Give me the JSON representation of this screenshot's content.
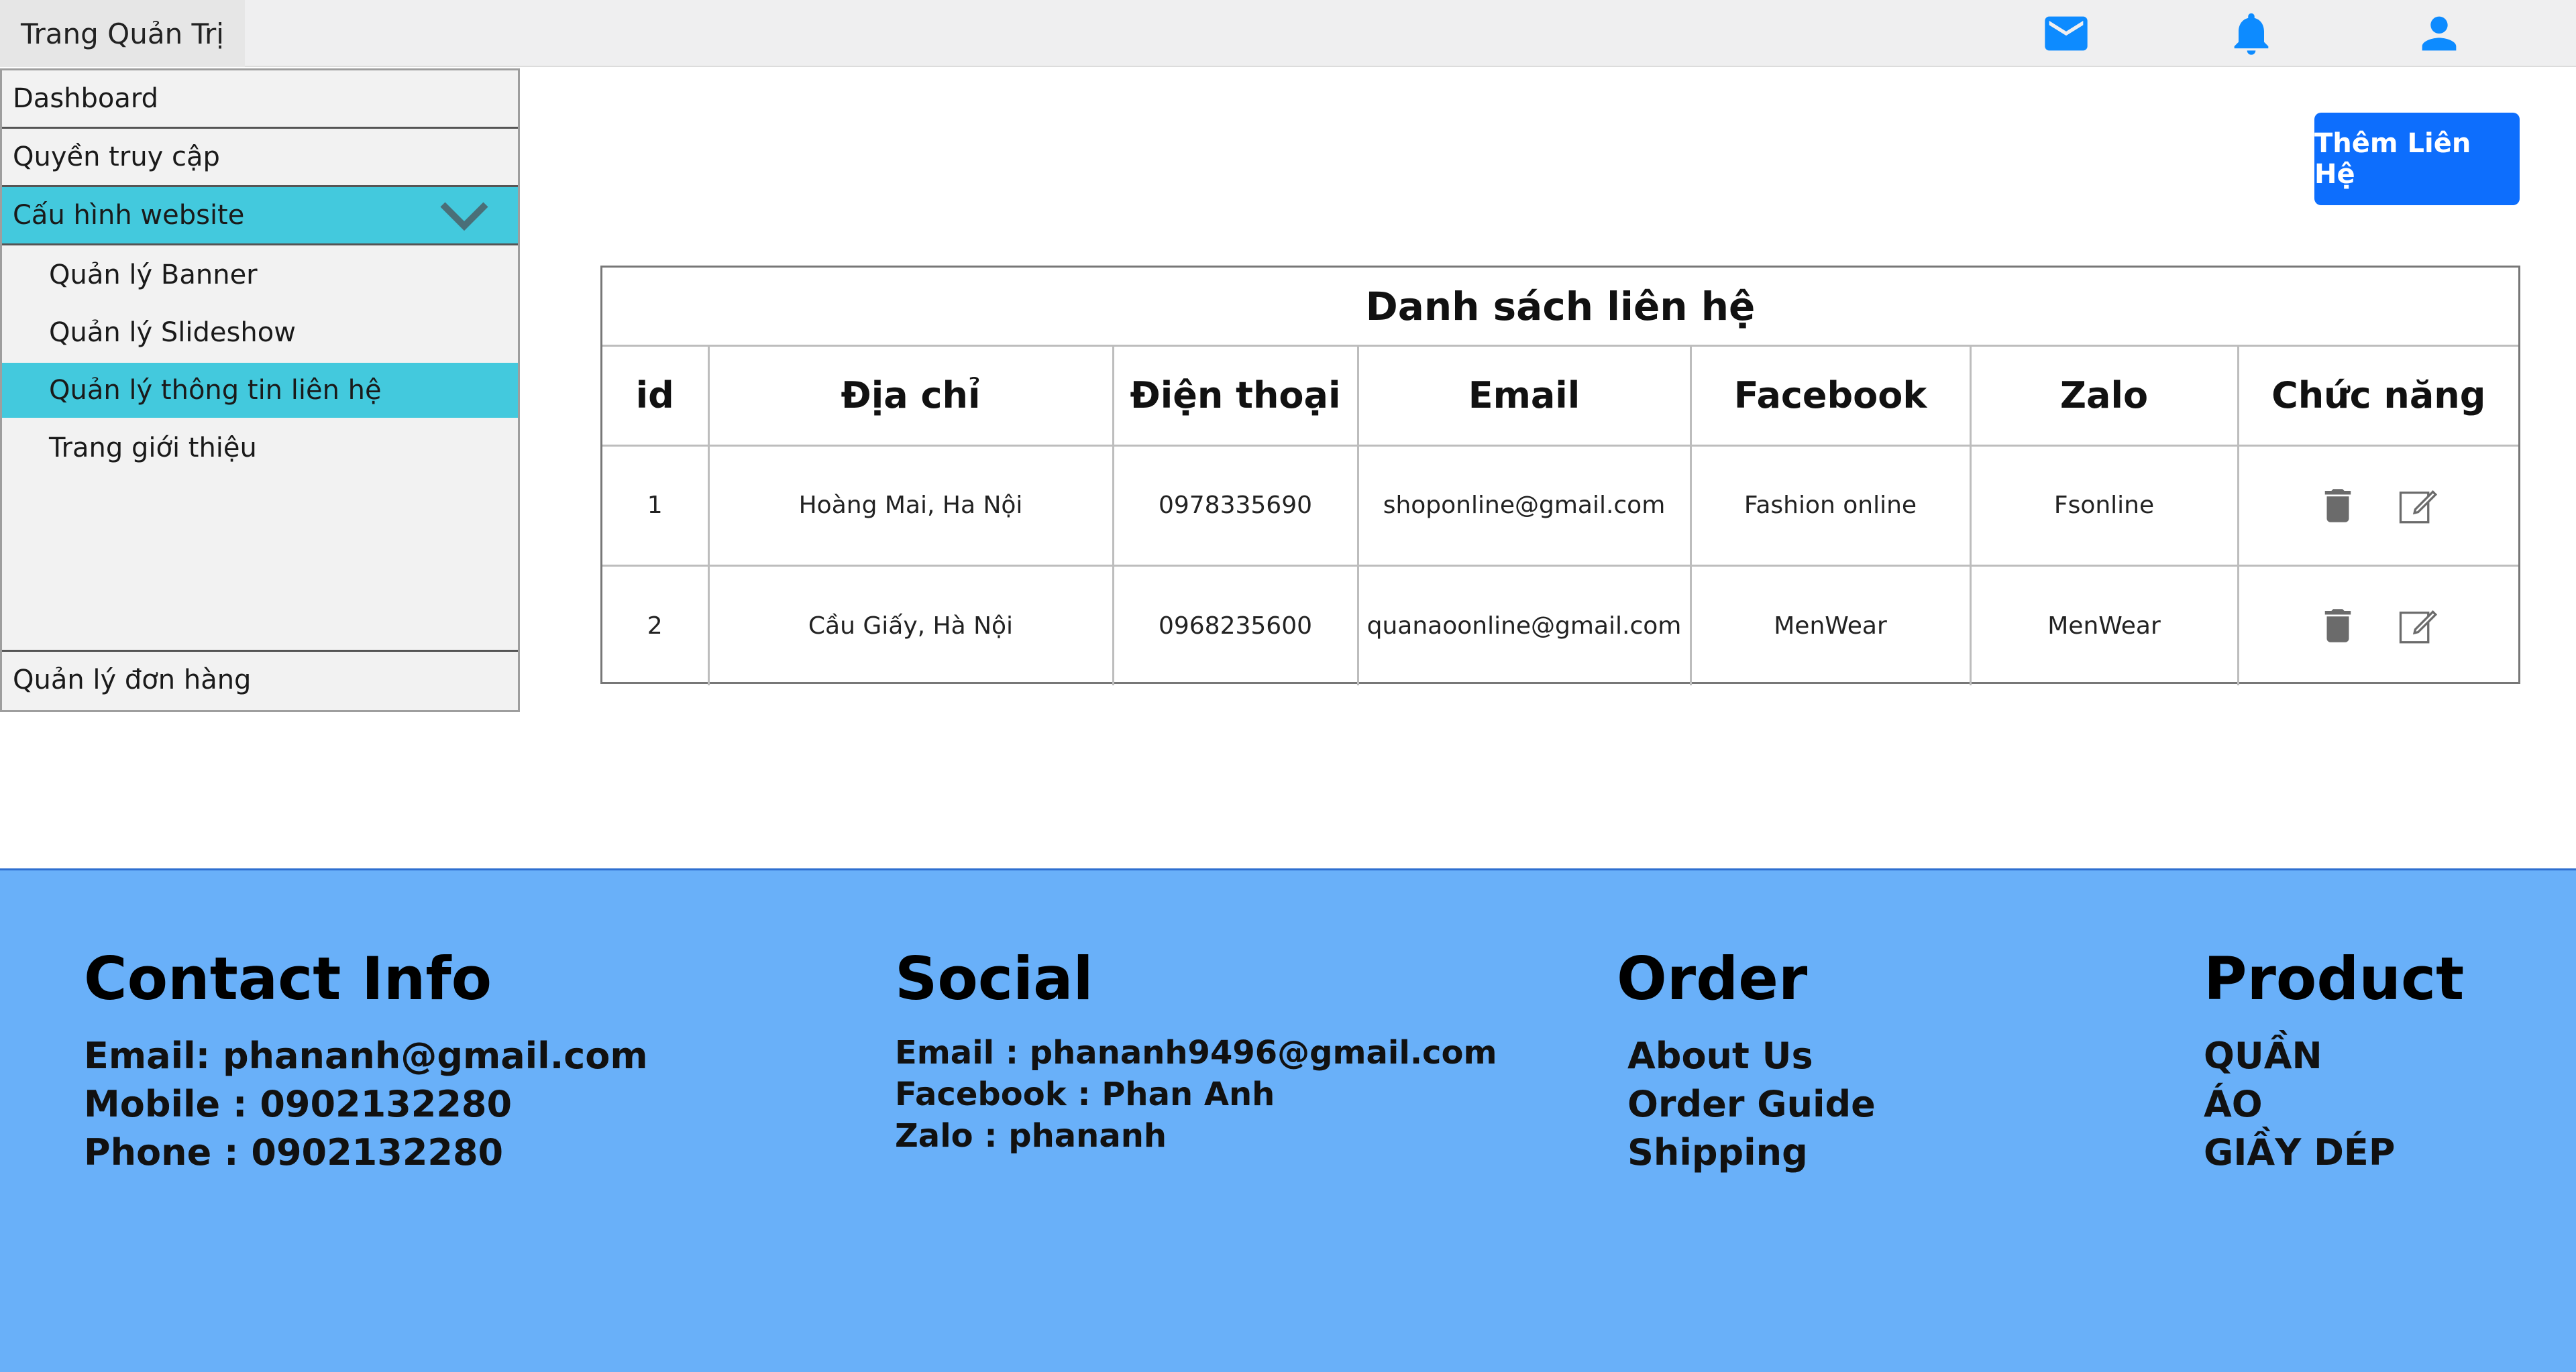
{
  "header": {
    "brand": "Trang Quản Trị",
    "icons": [
      "mail-icon",
      "bell-icon",
      "user-icon"
    ],
    "icon_color": "#0d8bff"
  },
  "sidebar": {
    "items": [
      {
        "label": "Dashboard"
      },
      {
        "label": "Quyền truy cập"
      },
      {
        "label": "Cấu hình website"
      },
      {
        "label": "Quản lý đơn hàng"
      }
    ],
    "subitems": [
      {
        "label": "Quản lý Banner"
      },
      {
        "label": "Quản lý Slideshow"
      },
      {
        "label": "Quản lý thông tin liên hệ"
      },
      {
        "label": "Trang giới thiệu"
      }
    ],
    "active_color": "#43c9dd"
  },
  "main": {
    "add_button": "Thêm Liên Hệ",
    "table": {
      "title": "Danh sách liên hệ",
      "columns": [
        "id",
        "Địa chỉ",
        "Điện thoại",
        "Email",
        "Facebook",
        "Zalo",
        "Chức năng"
      ],
      "rows": [
        {
          "id": "1",
          "address": "Hoàng Mai, Ha Nội",
          "phone": "0978335690",
          "email": "shoponline@gmail.com",
          "facebook": "Fashion online",
          "zalo": "Fsonline"
        },
        {
          "id": "2",
          "address": "Cầu Giấy, Hà Nội",
          "phone": "0968235600",
          "email": "quanaoonline@gmail.com",
          "facebook": "MenWear",
          "zalo": "MenWear"
        }
      ],
      "action_icons": [
        "trash-icon",
        "edit-icon"
      ]
    }
  },
  "footer": {
    "background": "#69b0f9",
    "contact": {
      "title": "Contact Info",
      "lines": [
        "Email: phananh@gmail.com",
        "Mobile : 0902132280",
        "Phone : 0902132280"
      ]
    },
    "social": {
      "title": "Social",
      "lines": [
        "Email : phananh9496@gmail.com",
        "Facebook : Phan Anh",
        "Zalo : phananh"
      ]
    },
    "order": {
      "title": "Order",
      "links": [
        "About Us",
        "Order Guide",
        "Shipping"
      ]
    },
    "product": {
      "title": "Product",
      "links": [
        "QUẦN",
        "ÁO",
        "GIẦY DÉP"
      ]
    }
  }
}
